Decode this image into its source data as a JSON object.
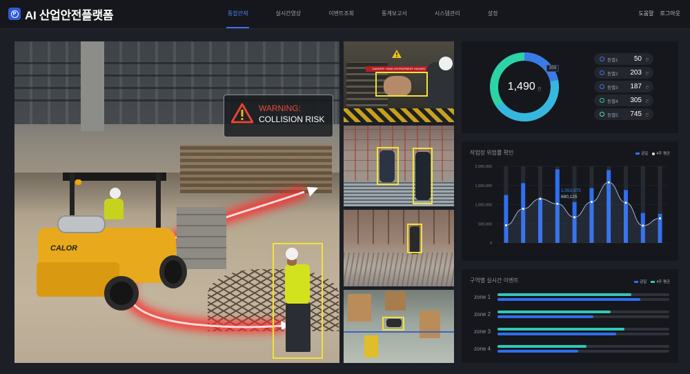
{
  "app": {
    "title": "AI 산업안전플랫폼",
    "logo_letter": "P"
  },
  "nav": {
    "items": [
      {
        "label": "통합관제",
        "active": true
      },
      {
        "label": "실시간영상",
        "active": false
      },
      {
        "label": "이벤트조회",
        "active": false
      },
      {
        "label": "통계보고서",
        "active": false
      },
      {
        "label": "시스템관리",
        "active": false
      },
      {
        "label": "설정",
        "active": false
      }
    ]
  },
  "header_right": {
    "help": "도움말",
    "logout": "로그아웃"
  },
  "main_camera": {
    "warning_title": "WARNING:",
    "warning_text": "COLLISION RISK",
    "forklift_brand": "CALOR"
  },
  "thumbnails": {
    "t1_sign": "DANGER: HAND ENTRAPMENT HAZARD"
  },
  "summary": {
    "total": "1,490",
    "total_unit": "건",
    "donut_tag": "203",
    "unit": "건",
    "buildings": [
      {
        "label": "동별1",
        "value": "50",
        "color": "#3b7be8"
      },
      {
        "label": "동별2",
        "value": "203",
        "color": "#3b7be8"
      },
      {
        "label": "동별3",
        "value": "187",
        "color": "#3b7be8"
      },
      {
        "label": "동별4",
        "value": "305",
        "color": "#2ad0b0"
      },
      {
        "label": "동별5",
        "value": "745",
        "color": "#5fe0c4"
      }
    ],
    "colors": {
      "blue": "#3b7be8",
      "teal": "#2ad0b0",
      "mint": "#5fe0c4"
    }
  },
  "risk_chart": {
    "title": "작업장 위험률 확인",
    "legend_bar": "금일",
    "legend_line": "4주 평균",
    "tooltip_bar": "1,053,575",
    "tooltip_line": "680,125"
  },
  "chart_data": {
    "type": "bar",
    "title": "작업장 위험률 확인",
    "y_ticks": [
      "2,000,000",
      "1,500,000",
      "1,000,000",
      "500,000",
      "0"
    ],
    "ylim": [
      0,
      2000000
    ],
    "series": [
      {
        "name": "금일",
        "values": [
          1250000,
          1560000,
          1170000,
          1920000,
          1070000,
          1430000,
          1900000,
          1380000,
          780000,
          760000
        ]
      },
      {
        "name": "4주 평균",
        "values": [
          460000,
          890000,
          1150000,
          1020000,
          670000,
          1070000,
          1580000,
          1050000,
          450000,
          640000
        ]
      }
    ]
  },
  "zone_events": {
    "title": "구역별 실시간 이벤트",
    "legend_a": "금일",
    "legend_b": "4주 평균",
    "zones": [
      {
        "label": "zone 1",
        "a": 0.78,
        "b": 0.83
      },
      {
        "label": "zone 2",
        "a": 0.66,
        "b": 0.56
      },
      {
        "label": "zone 3",
        "a": 0.74,
        "b": 0.69
      },
      {
        "label": "zone 4",
        "a": 0.52,
        "b": 0.47
      }
    ]
  }
}
